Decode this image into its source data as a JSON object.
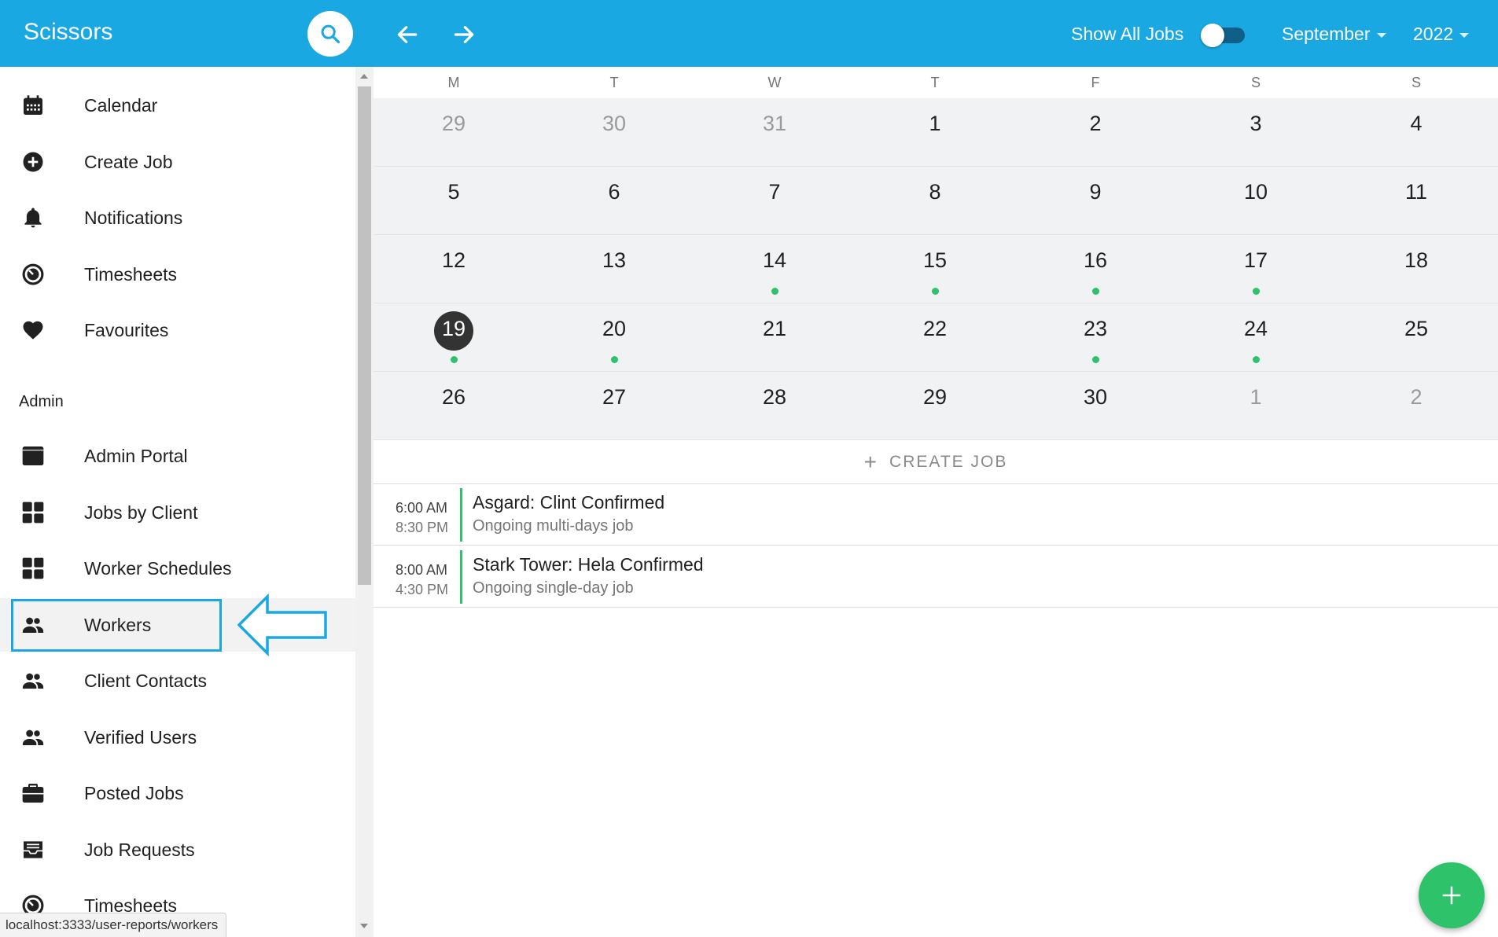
{
  "app": {
    "title": "Scissors"
  },
  "header": {
    "show_all_label": "Show All Jobs",
    "show_all_on": false,
    "month": "September",
    "year": "2022"
  },
  "sidebar": {
    "items": [
      {
        "label": "Calendar",
        "icon": "calendar-icon"
      },
      {
        "label": "Create Job",
        "icon": "add-circle-icon"
      },
      {
        "label": "Notifications",
        "icon": "bell-icon"
      },
      {
        "label": "Timesheets",
        "icon": "timer-icon"
      },
      {
        "label": "Favourites",
        "icon": "heart-icon"
      }
    ],
    "admin_label": "Admin",
    "admin_items": [
      {
        "label": "Admin Portal",
        "icon": "portal-icon"
      },
      {
        "label": "Jobs by Client",
        "icon": "grid-icon"
      },
      {
        "label": "Worker Schedules",
        "icon": "grid-icon"
      },
      {
        "label": "Workers",
        "icon": "people-icon"
      },
      {
        "label": "Client Contacts",
        "icon": "people-icon"
      },
      {
        "label": "Verified Users",
        "icon": "people-icon"
      },
      {
        "label": "Posted Jobs",
        "icon": "briefcase-icon"
      },
      {
        "label": "Job Requests",
        "icon": "inbox-icon"
      },
      {
        "label": "Timesheets",
        "icon": "timer-icon"
      }
    ]
  },
  "calendar": {
    "weekdays": [
      "M",
      "T",
      "W",
      "T",
      "F",
      "S",
      "S"
    ],
    "weeks": [
      [
        {
          "d": "29",
          "o": true
        },
        {
          "d": "30",
          "o": true
        },
        {
          "d": "31",
          "o": true
        },
        {
          "d": "1"
        },
        {
          "d": "2"
        },
        {
          "d": "3"
        },
        {
          "d": "4"
        }
      ],
      [
        {
          "d": "5"
        },
        {
          "d": "6"
        },
        {
          "d": "7"
        },
        {
          "d": "8"
        },
        {
          "d": "9"
        },
        {
          "d": "10"
        },
        {
          "d": "11"
        }
      ],
      [
        {
          "d": "12"
        },
        {
          "d": "13"
        },
        {
          "d": "14",
          "e": true
        },
        {
          "d": "15",
          "e": true
        },
        {
          "d": "16",
          "e": true
        },
        {
          "d": "17",
          "e": true
        },
        {
          "d": "18"
        }
      ],
      [
        {
          "d": "19",
          "e": true,
          "t": true
        },
        {
          "d": "20",
          "e": true
        },
        {
          "d": "21"
        },
        {
          "d": "22"
        },
        {
          "d": "23",
          "e": true
        },
        {
          "d": "24",
          "e": true
        },
        {
          "d": "25"
        }
      ],
      [
        {
          "d": "26"
        },
        {
          "d": "27"
        },
        {
          "d": "28"
        },
        {
          "d": "29"
        },
        {
          "d": "30"
        },
        {
          "d": "1",
          "o": true
        },
        {
          "d": "2",
          "o": true
        }
      ]
    ],
    "create_job_label": "CREATE JOB"
  },
  "events": [
    {
      "start": "6:00 AM",
      "end": "8:30 PM",
      "title": "Asgard: Clint Confirmed",
      "subtitle": "Ongoing multi-days job"
    },
    {
      "start": "8:00 AM",
      "end": "4:30 PM",
      "title": "Stark Tower: Hela Confirmed",
      "subtitle": "Ongoing single-day job"
    }
  ],
  "status_url": "localhost:3333/user-reports/workers",
  "colors": {
    "primary": "#1aa8e3",
    "accent_green": "#2ec26a",
    "today": "#333333"
  }
}
